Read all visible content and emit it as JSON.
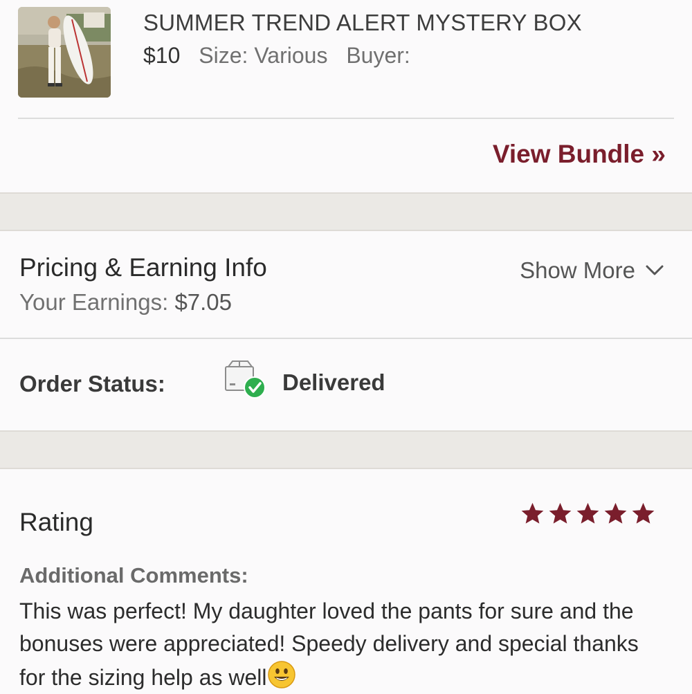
{
  "item": {
    "title": "SUMMER TREND ALERT MYSTERY BOX",
    "price": "$10",
    "size": "Size: Various",
    "buyer": "Buyer: ",
    "view_bundle": "View Bundle »"
  },
  "pricing": {
    "title": "Pricing & Earning Info",
    "earnings_label": "Your Earnings: ",
    "earnings_value": "$7.05",
    "show_more": "Show More"
  },
  "order": {
    "label": "Order Status:",
    "status": "Delivered"
  },
  "rating": {
    "title": "Rating",
    "stars": 5,
    "comments_label": "Additional Comments:",
    "comment": "This was perfect! My daughter loved the pants for sure and the bonuses were appreciated! Speedy delivery and special thanks for the sizing help as well"
  },
  "colors": {
    "accent": "#7a1e2c",
    "delivered_green": "#2eae4e"
  },
  "icons": [
    "chevron-down-icon",
    "package-delivered-icon",
    "star-icon",
    "smiley-emoji-icon"
  ]
}
